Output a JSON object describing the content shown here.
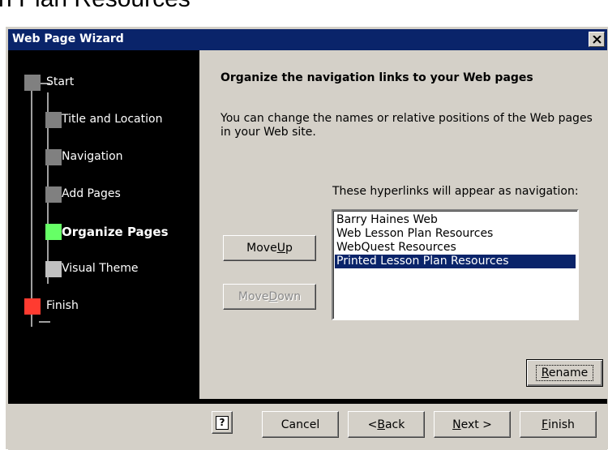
{
  "background_caption": "n Plan Resources",
  "window": {
    "title": "Web Page Wizard",
    "close_glyph": "×"
  },
  "steps": [
    {
      "label": "Start",
      "color": "#808080",
      "active": false
    },
    {
      "label": "Title and Location",
      "color": "#808080",
      "active": false
    },
    {
      "label": "Navigation",
      "color": "#808080",
      "active": false
    },
    {
      "label": "Add Pages",
      "color": "#808080",
      "active": false
    },
    {
      "label": "Organize Pages",
      "color": "#66ff66",
      "active": true
    },
    {
      "label": "Visual Theme",
      "color": "#c0c0c0",
      "active": false
    },
    {
      "label": "Finish",
      "color": "#ff3b30",
      "active": false
    }
  ],
  "main": {
    "heading": "Organize the navigation links to your Web pages",
    "description": "You can change the names or relative positions of the Web pages in your Web site.",
    "list_caption": "These hyperlinks will appear as navigation:",
    "move_up": {
      "pre": "Move ",
      "mnemonic": "U",
      "post": "p"
    },
    "move_down": {
      "pre": "Move ",
      "mnemonic": "D",
      "post": "own"
    },
    "list_items": [
      {
        "label": "Barry Haines Web",
        "selected": false
      },
      {
        "label": "Web Lesson Plan Resources",
        "selected": false
      },
      {
        "label": "WebQuest Resources",
        "selected": false
      },
      {
        "label": "Printed Lesson Plan Resources",
        "selected": true
      }
    ],
    "rename": {
      "pre": "",
      "mnemonic": "R",
      "post": "ename"
    }
  },
  "footer": {
    "help_glyph": "?",
    "cancel": "Cancel",
    "back": {
      "pre": "< ",
      "mnemonic": "B",
      "post": "ack"
    },
    "next": {
      "pre": "",
      "mnemonic": "N",
      "post": "ext >"
    },
    "finish": {
      "pre": "",
      "mnemonic": "F",
      "post": "inish"
    }
  },
  "colors": {
    "titlebar": "#0a246a",
    "selection": "#0a246a",
    "face": "#d4d0c8"
  }
}
